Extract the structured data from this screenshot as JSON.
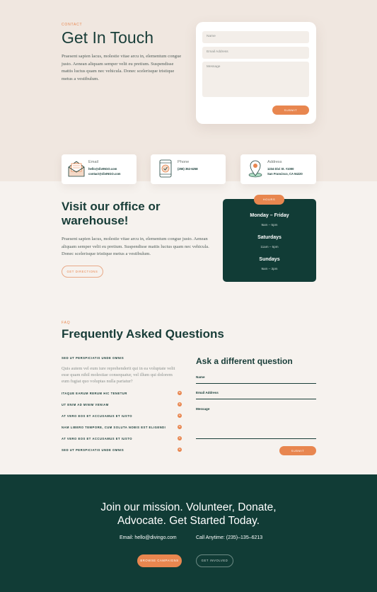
{
  "contact": {
    "overline": "CONTACT",
    "title": "Get In Touch",
    "body": "Praesent sapien lacus, molestie vitae arcu in, elementum congue justo. Aenean aliquam semper velit eu pretium. Suspendisse mattis luctus quam nec vehicula. Donec scelerisque tristique metus a vestibulum.",
    "form": {
      "name_placeholder": "Name",
      "email_placeholder": "Email Address",
      "message_placeholder": "Message",
      "submit_label": "SUBMIT"
    }
  },
  "info_cards": [
    {
      "title": "Email",
      "lines": [
        "hello@divINGO.com",
        "contact@divINGO.com"
      ],
      "icon": "envelope-icon"
    },
    {
      "title": "Phone",
      "lines": [
        "(255) 352-6258"
      ],
      "icon": "phone-icon"
    },
    {
      "title": "Address",
      "lines": [
        "1234 Divi St. #1000",
        "San Francisco, CA 94220"
      ],
      "icon": "map-pin-icon"
    }
  ],
  "visit": {
    "title": "Visit our office or warehouse!",
    "body": "Praesent sapien lacus, molestie vitae arcu in, elementum congue justo. Aenean aliquam semper velit eu pretium. Suspendisse mattis luctus quam nec vehicula. Donec scelerisque tristique metus a vestibulum.",
    "button_label": "GET DIRECTIONS"
  },
  "hours": {
    "badge": "HOURS",
    "entries": [
      {
        "day": "Monday – Friday",
        "time": "9am – 5pm"
      },
      {
        "day": "Saturdays",
        "time": "11am – 5pm"
      },
      {
        "day": "Sundays",
        "time": "9am – 3pm"
      }
    ]
  },
  "faq": {
    "overline": "FAQ",
    "title": "Frequently Asked Questions",
    "open_question": "SED UT PERSPICIATIS UNDE OMNIS",
    "open_answer": "Quis autem vel eum iure reprehenderit qui in ea voluptate velit esse quam nihil molestiae consequatur, vel illum qui dolorem eum fugiat quo voluptas nulla pariatur?",
    "items": [
      "ITAQUE EARUM RERUM HIC TENETUR",
      "UT ENIM AD MINIM VENIAM",
      "AT VERO EOS ET ACCUSAMUS ET IUSTO",
      "NAM LIBERO TEMPORE, CUM SOLUTA NOBIS EST ELIGENDI",
      "AT VERO EOS ET ACCUSAMUS ET IUSTO",
      "SED UT PERSPICIATIS UNDE OMNIS"
    ],
    "plus_symbol": "+"
  },
  "ask": {
    "title": "Ask a different question",
    "name_label": "Name",
    "email_label": "Email Address",
    "message_label": "Message",
    "submit_label": "SUBMIT"
  },
  "cta": {
    "title_line1": "Join our mission. Volunteer, Donate,",
    "title_line2": "Advocate. Get Started Today.",
    "email_text": "Email: hello@divingo.com",
    "phone_text": "Call Anytime: (235)–135–6213",
    "primary_button": "BROWSE CAMPAIGNS",
    "secondary_button": "GET INVOLVED"
  },
  "colors": {
    "accent": "#e8864f",
    "dark_green": "#113c36",
    "hero_bg": "#f0e7e0",
    "page_bg": "#f6f2ee"
  }
}
